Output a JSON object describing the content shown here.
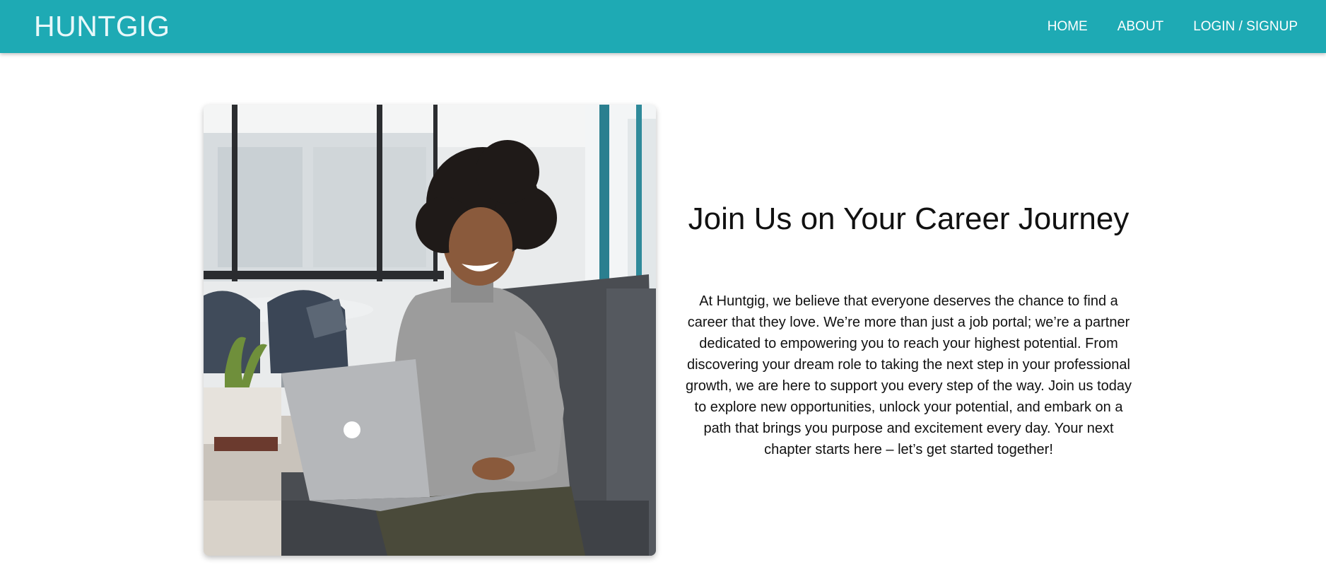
{
  "navbar": {
    "brand": "HUNTGIG",
    "links": [
      "HOME",
      "ABOUT",
      "LOGIN / SIGNUP"
    ],
    "background_color": "#1eaab4"
  },
  "hero": {
    "photo_icon": "woman-with-laptop-photo",
    "title": "Join Us on Your Career Journey",
    "paragraph": "At Huntgig, we believe that everyone deserves the chance to find a career that they love. We’re more than just a job portal; we’re a partner dedicated to empowering you to reach your highest potential. From discovering your dream role to taking the next step in your professional growth, we are here to support you every step of the way. Join us today to explore new opportunities, unlock your potential, and embark on a path that brings you purpose and excitement every day. Your next chapter starts here – let’s get started together!"
  }
}
